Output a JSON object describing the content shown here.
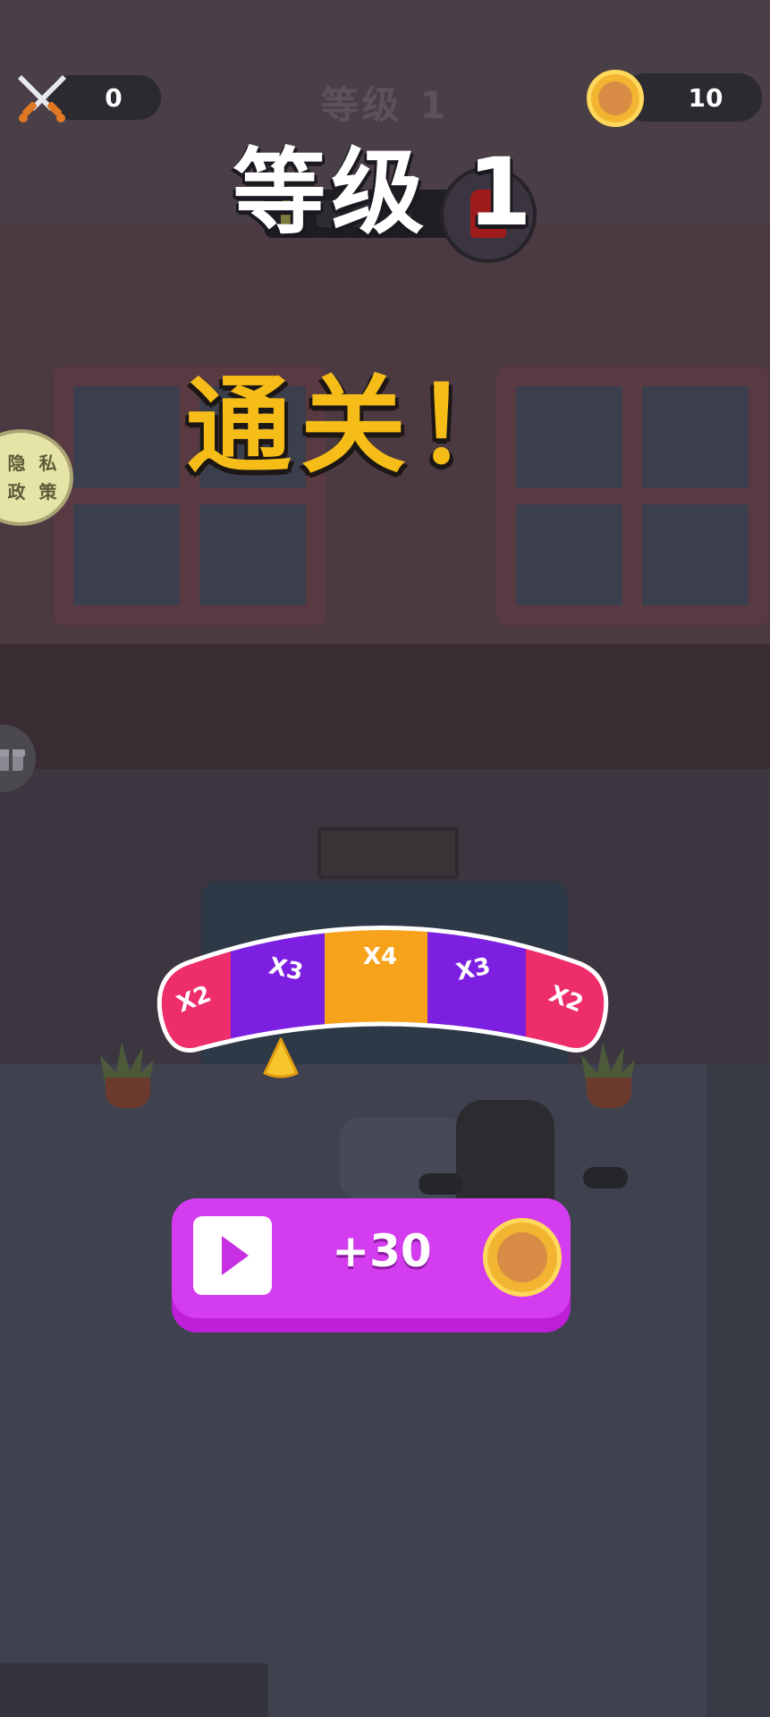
{
  "hud": {
    "kills": "0",
    "coins": "10",
    "level_small": "等级 1"
  },
  "level_banner": "等级 1",
  "level_progress": {
    "segments_total": 4,
    "segments_filled": 1
  },
  "result_text": "通关！",
  "privacy_button": {
    "line1": "隐 私",
    "line2": "政 策"
  },
  "multiplier_wheel": {
    "segments": [
      {
        "label": "X2",
        "color": "#ee2d6b"
      },
      {
        "label": "X3",
        "color": "#7d1fe0"
      },
      {
        "label": "X4",
        "color": "#f7a21b"
      },
      {
        "label": "X3",
        "color": "#7d1fe0"
      },
      {
        "label": "X2",
        "color": "#ee2d6b"
      }
    ]
  },
  "bonus_button": {
    "label": "+30"
  },
  "colors": {
    "accent": "#d43cf0",
    "title_yellow": "#f6bd19",
    "coin": "#f2b531"
  },
  "icons": {
    "kills": "crossed-swords-icon",
    "coins": "coin-icon",
    "play": "play-icon",
    "side": "gift-icon"
  }
}
